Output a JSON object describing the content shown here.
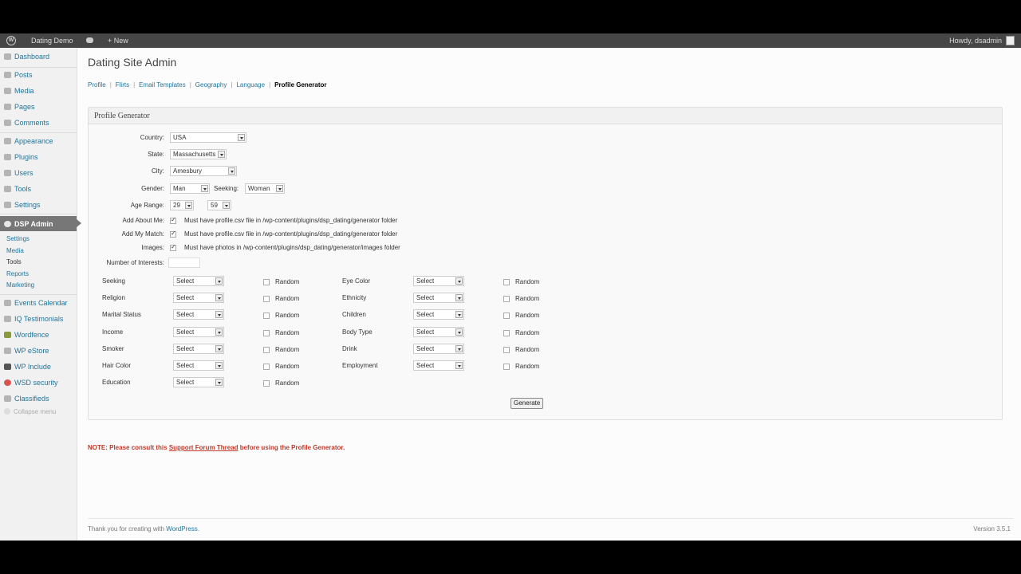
{
  "adminbar": {
    "site_name": "Dating Demo",
    "new_label": "+ New",
    "howdy": "Howdy, dsadmin"
  },
  "sidebar": {
    "items": [
      {
        "label": "Dashboard",
        "icon": "dashboard-icon"
      },
      {
        "label": "Posts",
        "icon": "pin-icon"
      },
      {
        "label": "Media",
        "icon": "media-icon"
      },
      {
        "label": "Pages",
        "icon": "pages-icon"
      },
      {
        "label": "Comments",
        "icon": "comments-icon"
      },
      {
        "label": "Appearance",
        "icon": "appearance-icon"
      },
      {
        "label": "Plugins",
        "icon": "plugins-icon"
      },
      {
        "label": "Users",
        "icon": "users-icon"
      },
      {
        "label": "Tools",
        "icon": "tools-icon"
      },
      {
        "label": "Settings",
        "icon": "settings-icon"
      },
      {
        "label": "DSP Admin",
        "icon": "gear-icon"
      },
      {
        "label": "Events Calendar",
        "icon": "calendar-icon"
      },
      {
        "label": "IQ Testimonials",
        "icon": "testimonials-icon"
      },
      {
        "label": "Wordfence",
        "icon": "wordfence-icon"
      },
      {
        "label": "WP eStore",
        "icon": "store-icon"
      },
      {
        "label": "WP Include",
        "icon": "include-icon"
      },
      {
        "label": "WSD security",
        "icon": "security-icon"
      },
      {
        "label": "Classifieds",
        "icon": "tag-icon"
      }
    ],
    "subitems": [
      "Settings",
      "Media",
      "Tools",
      "Reports",
      "Marketing"
    ],
    "collapse": "Collapse menu"
  },
  "page": {
    "title": "Dating Site Admin",
    "subnav": [
      "Profile",
      "Flirts",
      "Email Templates",
      "Geography",
      "Language",
      "Profile Generator"
    ]
  },
  "generator": {
    "box_title": "Profile Generator",
    "country_label": "Country:",
    "country_value": "USA",
    "state_label": "State:",
    "state_value": "Massachusetts",
    "city_label": "City:",
    "city_value": "Amesbury",
    "gender_label": "Gender:",
    "gender_value": "Man",
    "seeking_label": "Seeking:",
    "seeking_value": "Woman",
    "age_label": "Age Range:",
    "age_from": "29",
    "age_to": "59",
    "about_label": "Add About Me:",
    "about_note": "Must have profile.csv file in /wp-content/plugins/dsp_dating/generator folder",
    "match_label": "Add My Match:",
    "match_note": "Must have profile.csv file in /wp-content/plugins/dsp_dating/generator folder",
    "images_label": "Images:",
    "images_note": "Must have photos in /wp-content/plugins/dsp_dating/generator/images folder",
    "interests_label": "Number of Interests:",
    "select_default": "Select",
    "random_label": "Random",
    "left_fields": [
      "Seeking",
      "Religion",
      "Marital Status",
      "Income",
      "Smoker",
      "Hair Color",
      "Education"
    ],
    "right_fields": [
      "Eye Color",
      "Ethnicity",
      "Children",
      "Body Type",
      "Drink",
      "Employment"
    ],
    "generate_button": "Generate"
  },
  "note": {
    "prefix": "NOTE: Please consult this ",
    "link": "Support Forum Thread",
    "suffix": " before using the Profile Generator."
  },
  "footer": {
    "thanks_prefix": "Thank you for creating with ",
    "thanks_link": "WordPress",
    "thanks_suffix": ".",
    "version": "Version 3.5.1"
  }
}
